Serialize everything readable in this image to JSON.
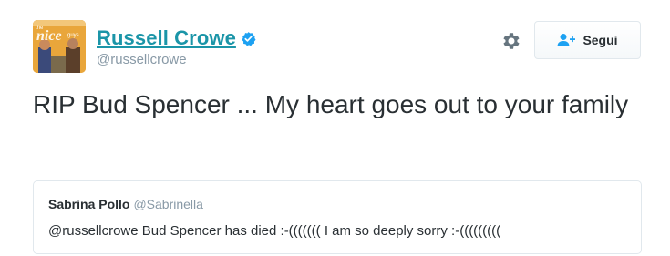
{
  "author": {
    "display_name": "Russell Crowe",
    "handle": "@russellcrowe",
    "verified": true,
    "avatar_icon": "profile-photo-movie-poster",
    "avatar_poster_title": "the nice guys"
  },
  "actions": {
    "settings_icon": "gear-icon",
    "follow_label": "Segui",
    "follow_icon": "add-user-icon"
  },
  "tweet": {
    "text": "RIP Bud Spencer ... My heart goes out to your family"
  },
  "quoted_tweet": {
    "author_name": "Sabrina Pollo",
    "author_handle": "@Sabrinella",
    "text": "@russellcrowe Bud Spencer has died :-((((((( I am so deeply sorry :-((((((((("
  },
  "colors": {
    "name_link": "#1b95a8",
    "verified_badge": "#1da1f2",
    "secondary_text": "#8899a6",
    "primary_text": "#292f33",
    "border": "#e1e8ed",
    "follow_icon": "#1da1f2"
  }
}
